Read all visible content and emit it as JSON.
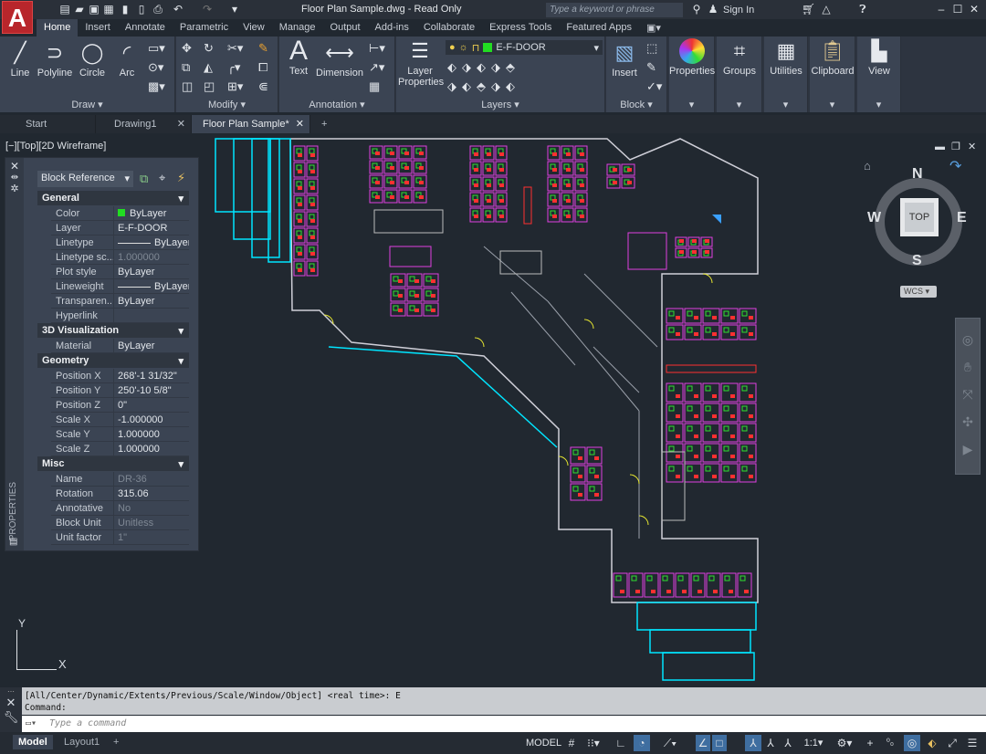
{
  "app": {
    "title": "Floor Plan Sample.dwg - Read Only",
    "logo": "A",
    "search_placeholder": "Type a keyword or phrase",
    "sign_in": "Sign In"
  },
  "ribbon_tabs": [
    "Home",
    "Insert",
    "Annotate",
    "Parametric",
    "View",
    "Manage",
    "Output",
    "Add-ins",
    "Collaborate",
    "Express Tools",
    "Featured Apps"
  ],
  "panels": {
    "draw": {
      "title": "Draw",
      "tools": [
        "Line",
        "Polyline",
        "Circle",
        "Arc"
      ]
    },
    "modify": {
      "title": "Modify"
    },
    "annotation": {
      "title": "Annotation",
      "tools": [
        "Text",
        "Dimension"
      ]
    },
    "layers": {
      "title": "Layers",
      "tool": "Layer Properties",
      "current_layer": "E-F-DOOR",
      "layer_color": "#22dd22"
    },
    "block": {
      "title": "Block",
      "tool": "Insert"
    },
    "big": [
      "Properties",
      "Groups",
      "Utilities",
      "Clipboard",
      "View"
    ]
  },
  "doc_tabs": [
    "Start",
    "Drawing1",
    "Floor Plan Sample*"
  ],
  "viewport": {
    "label": "[−][Top][2D Wireframe]",
    "viewcube": {
      "top": "TOP",
      "n": "N",
      "s": "S",
      "e": "E",
      "w": "W",
      "ucs": "WCS"
    },
    "ucs_x": "X",
    "ucs_y": "Y"
  },
  "properties": {
    "palette_title": "PROPERTIES",
    "selection": "Block Reference",
    "sections": [
      {
        "name": "General",
        "rows": [
          [
            "Color",
            "ByLayer"
          ],
          [
            "Layer",
            "E-F-DOOR"
          ],
          [
            "Linetype",
            "ByLayer"
          ],
          [
            "Linetype sc...",
            "1.000000"
          ],
          [
            "Plot style",
            "ByLayer"
          ],
          [
            "Lineweight",
            "ByLayer"
          ],
          [
            "Transparen...",
            "ByLayer"
          ],
          [
            "Hyperlink",
            ""
          ]
        ]
      },
      {
        "name": "3D Visualization",
        "rows": [
          [
            "Material",
            "ByLayer"
          ]
        ]
      },
      {
        "name": "Geometry",
        "rows": [
          [
            "Position X",
            "268'-1 31/32\""
          ],
          [
            "Position Y",
            "250'-10 5/8\""
          ],
          [
            "Position Z",
            "0\""
          ],
          [
            "Scale X",
            "-1.000000"
          ],
          [
            "Scale Y",
            "1.000000"
          ],
          [
            "Scale Z",
            "1.000000"
          ]
        ]
      },
      {
        "name": "Misc",
        "rows": [
          [
            "Name",
            "DR-36"
          ],
          [
            "Rotation",
            "315.06"
          ],
          [
            "Annotative",
            "No"
          ],
          [
            "Block Unit",
            "Unitless"
          ],
          [
            "Unit factor",
            "1\""
          ]
        ]
      }
    ]
  },
  "command": {
    "history": "[All/Center/Dynamic/Extents/Previous/Scale/Window/Object] <real time>: E",
    "prompt": "Command:",
    "placeholder": "Type a command"
  },
  "layout_tabs": [
    "Model",
    "Layout1"
  ],
  "status": {
    "model": "MODEL",
    "scale": "1:1"
  },
  "colors": {
    "accent": "#3f6ea0",
    "cyan": "#00e5ff",
    "magenta": "#e040e0",
    "green": "#30e030",
    "yellow": "#e8e830",
    "red": "#ff3030"
  }
}
